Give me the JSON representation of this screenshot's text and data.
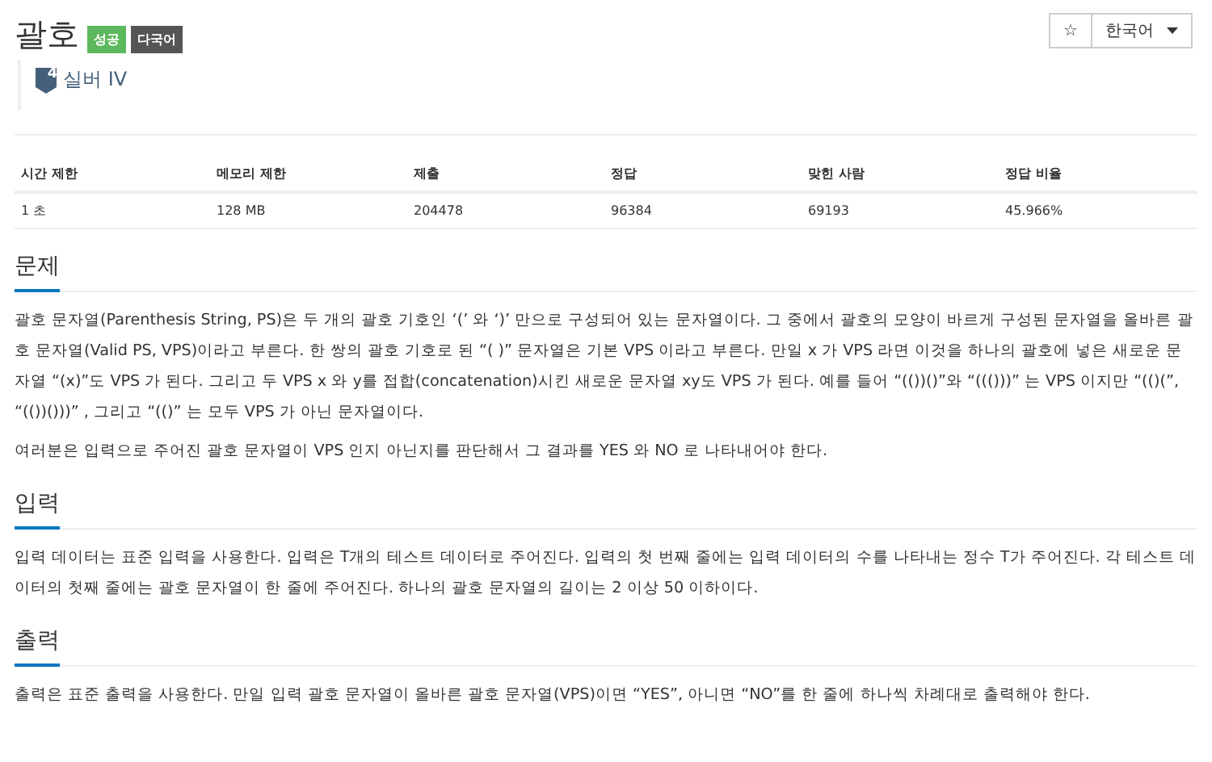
{
  "title": "괄호",
  "labels": [
    {
      "text": "성공",
      "color": "#5cb85c"
    },
    {
      "text": "다국어",
      "color": "#555555"
    }
  ],
  "tier": {
    "badge": "4",
    "name": "실버 IV"
  },
  "actions": {
    "star": "☆",
    "language": "한국어"
  },
  "table": {
    "columns": [
      "시간 제한",
      "메모리 제한",
      "제출",
      "정답",
      "맞힌 사람",
      "정답 비율"
    ],
    "rows": [
      [
        "1 초",
        "128 MB",
        "204478",
        "96384",
        "69193",
        "45.966%"
      ]
    ]
  },
  "sections": [
    {
      "heading": "문제",
      "paragraphs": [
        "괄호 문자열(Parenthesis String, PS)은 두 개의 괄호 기호인 ‘(’ 와 ‘)’ 만으로 구성되어 있는 문자열이다. 그 중에서 괄호의 모양이 바르게 구성된 문자열을 올바른 괄호 문자열(Valid PS, VPS)이라고 부른다. 한 쌍의 괄호 기호로 된 “( )” 문자열은 기본 VPS 이라고 부른다. 만일 x 가 VPS 라면 이것을 하나의 괄호에 넣은 새로운 문자열 “(x)”도 VPS 가 된다. 그리고 두 VPS x 와 y를 접합(concatenation)시킨 새로운 문자열 xy도 VPS 가 된다. 예를 들어 “(())()”와 “((()))” 는 VPS 이지만 “(()(”, “(())()))” , 그리고 “(()” 는 모두 VPS 가 아닌 문자열이다.",
        "여러분은 입력으로 주어진 괄호 문자열이 VPS 인지 아닌지를 판단해서 그 결과를 YES 와 NO 로 나타내어야 한다."
      ]
    },
    {
      "heading": "입력",
      "paragraphs": [
        "입력 데이터는 표준 입력을 사용한다. 입력은 T개의 테스트 데이터로 주어진다. 입력의 첫 번째 줄에는 입력 데이터의 수를 나타내는 정수 T가 주어진다. 각 테스트 데이터의 첫째 줄에는 괄호 문자열이 한 줄에 주어진다. 하나의 괄호 문자열의 길이는 2 이상 50 이하이다."
      ]
    },
    {
      "heading": "출력",
      "paragraphs": [
        "출력은 표준 출력을 사용한다. 만일 입력 괄호 문자열이 올바른 괄호 문자열(VPS)이면 “YES”, 아니면 “NO”를 한 줄에 하나씩 차례대로 출력해야 한다."
      ]
    }
  ]
}
